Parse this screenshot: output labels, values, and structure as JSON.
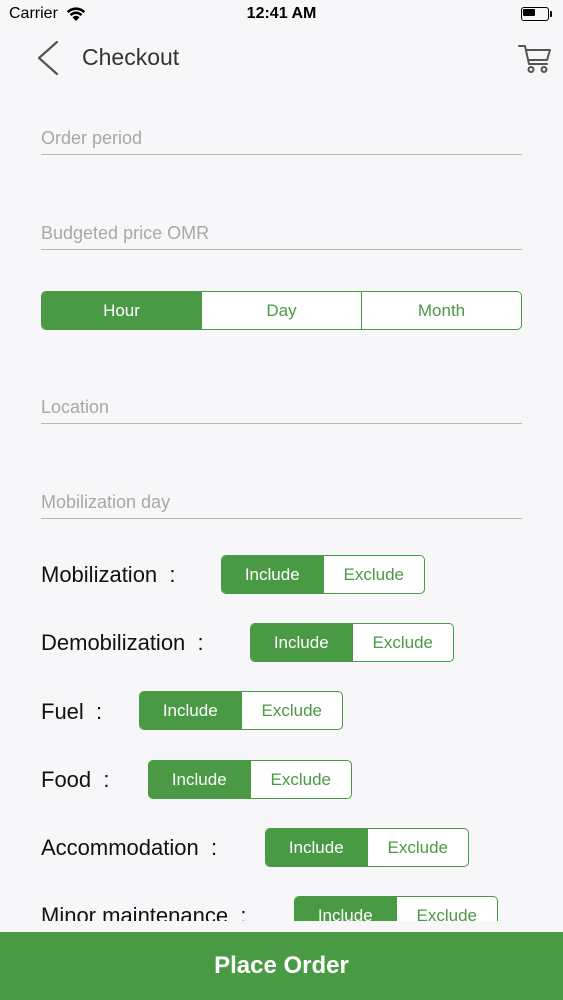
{
  "status_bar": {
    "carrier": "Carrier",
    "time": "12:41 AM"
  },
  "nav": {
    "title": "Checkout"
  },
  "fields": {
    "order_period": {
      "placeholder": "Order period"
    },
    "budgeted_price": {
      "placeholder": "Budgeted price OMR"
    },
    "location": {
      "placeholder": "Location"
    },
    "mobilization_day": {
      "placeholder": "Mobilization day"
    }
  },
  "period_unit": {
    "options": [
      "Hour",
      "Day",
      "Month"
    ],
    "selected": "Hour"
  },
  "options": [
    {
      "label": "Mobilization  :",
      "include": "Include",
      "exclude": "Exclude",
      "selected": "Include"
    },
    {
      "label": "Demobilization  :",
      "include": "Include",
      "exclude": "Exclude",
      "selected": "Include"
    },
    {
      "label": "Fuel  :",
      "include": "Include",
      "exclude": "Exclude",
      "selected": "Include"
    },
    {
      "label": "Food  :",
      "include": "Include",
      "exclude": "Exclude",
      "selected": "Include"
    },
    {
      "label": "Accommodation  :",
      "include": "Include",
      "exclude": "Exclude",
      "selected": "Include"
    },
    {
      "label": "Minor maintenance  :",
      "include": "Include",
      "exclude": "Exclude",
      "selected": "Include"
    }
  ],
  "footer": {
    "place_order_label": "Place Order"
  },
  "colors": {
    "accent": "#4a9a45",
    "background": "#f7f7f9"
  }
}
